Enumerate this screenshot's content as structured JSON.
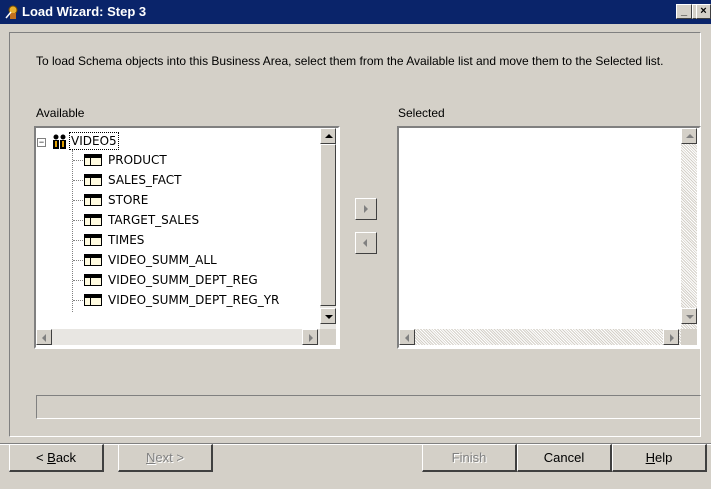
{
  "window": {
    "title": "Load Wizard: Step 3",
    "min_glyph": "_",
    "max_glyph": "□",
    "close_glyph": "×"
  },
  "instruction": "To load Schema objects into this Business Area, select them from the Available list and move them to the Selected list.",
  "available": {
    "label": "Available",
    "root": {
      "expander": "−",
      "label": "VIDEO5"
    },
    "items": [
      "PRODUCT",
      "SALES_FACT",
      "STORE",
      "TARGET_SALES",
      "TIMES",
      "VIDEO_SUMM_ALL",
      "VIDEO_SUMM_DEPT_REG",
      "VIDEO_SUMM_DEPT_REG_YR"
    ]
  },
  "selected": {
    "label": "Selected",
    "items": []
  },
  "progress_percent": 0,
  "buttons": {
    "back": {
      "prefix": "< ",
      "mnemonic": "B",
      "rest": "ack"
    },
    "next": {
      "mnemonic": "N",
      "rest": "ext >"
    },
    "finish": "Finish",
    "cancel": "Cancel",
    "help": {
      "mnemonic": "H",
      "rest": "elp"
    }
  },
  "colors": {
    "titlebar": "#0a246a",
    "dialog": "#d4d0c8"
  },
  "icons": [
    "wizard-icon",
    "users-icon",
    "table-icon",
    "move-right-icon",
    "move-left-icon"
  ]
}
